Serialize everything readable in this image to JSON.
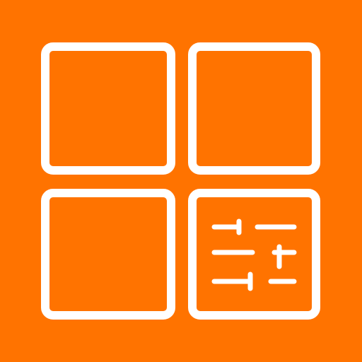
{
  "icon": {
    "name": "app-grid-settings-icon",
    "colors": {
      "background": "#FF7300",
      "stroke": "#FFFFFF"
    },
    "tiles": [
      {
        "name": "app-tile-top-left",
        "content": "empty"
      },
      {
        "name": "app-tile-top-right",
        "content": "empty"
      },
      {
        "name": "app-tile-bottom-left",
        "content": "empty"
      },
      {
        "name": "app-tile-bottom-right",
        "content": "sliders-icon"
      }
    ],
    "sliders": {
      "icon": "sliders-icon",
      "count": 3
    }
  }
}
